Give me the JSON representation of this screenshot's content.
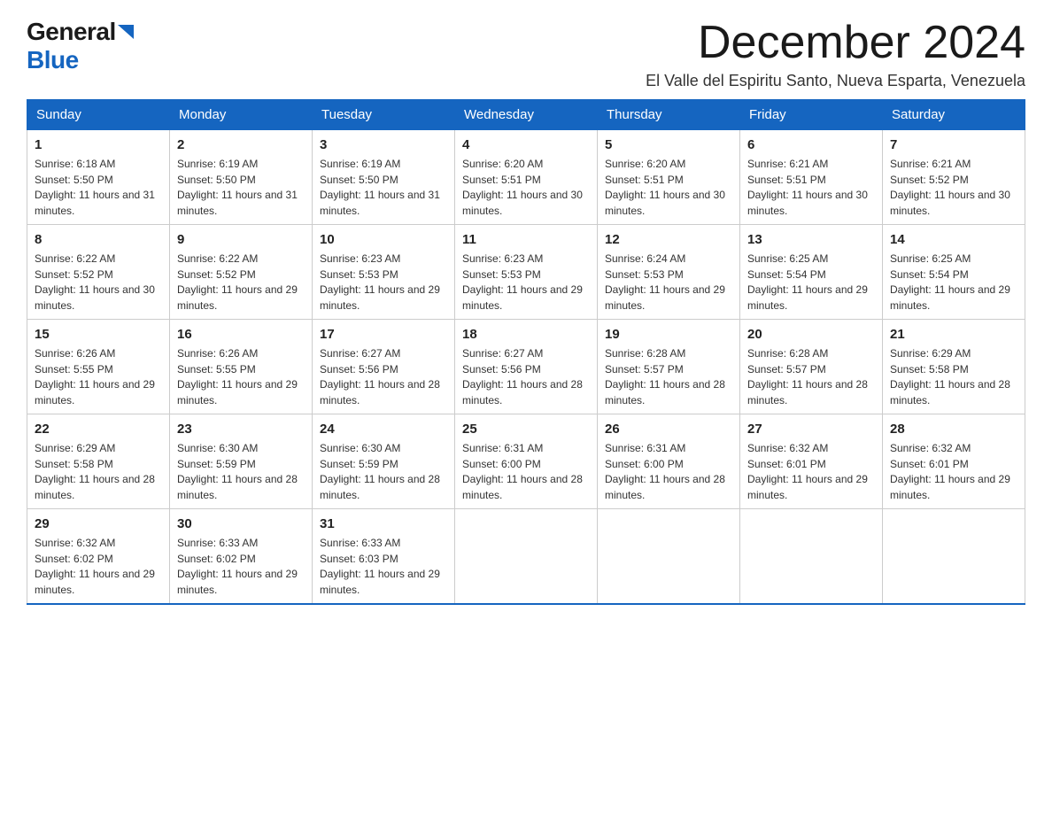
{
  "header": {
    "logo_general": "General",
    "logo_blue": "Blue",
    "month_title": "December 2024",
    "subtitle": "El Valle del Espiritu Santo, Nueva Esparta, Venezuela"
  },
  "weekdays": [
    "Sunday",
    "Monday",
    "Tuesday",
    "Wednesday",
    "Thursday",
    "Friday",
    "Saturday"
  ],
  "weeks": [
    [
      {
        "day": "1",
        "sunrise": "6:18 AM",
        "sunset": "5:50 PM",
        "daylight": "11 hours and 31 minutes."
      },
      {
        "day": "2",
        "sunrise": "6:19 AM",
        "sunset": "5:50 PM",
        "daylight": "11 hours and 31 minutes."
      },
      {
        "day": "3",
        "sunrise": "6:19 AM",
        "sunset": "5:50 PM",
        "daylight": "11 hours and 31 minutes."
      },
      {
        "day": "4",
        "sunrise": "6:20 AM",
        "sunset": "5:51 PM",
        "daylight": "11 hours and 30 minutes."
      },
      {
        "day": "5",
        "sunrise": "6:20 AM",
        "sunset": "5:51 PM",
        "daylight": "11 hours and 30 minutes."
      },
      {
        "day": "6",
        "sunrise": "6:21 AM",
        "sunset": "5:51 PM",
        "daylight": "11 hours and 30 minutes."
      },
      {
        "day": "7",
        "sunrise": "6:21 AM",
        "sunset": "5:52 PM",
        "daylight": "11 hours and 30 minutes."
      }
    ],
    [
      {
        "day": "8",
        "sunrise": "6:22 AM",
        "sunset": "5:52 PM",
        "daylight": "11 hours and 30 minutes."
      },
      {
        "day": "9",
        "sunrise": "6:22 AM",
        "sunset": "5:52 PM",
        "daylight": "11 hours and 29 minutes."
      },
      {
        "day": "10",
        "sunrise": "6:23 AM",
        "sunset": "5:53 PM",
        "daylight": "11 hours and 29 minutes."
      },
      {
        "day": "11",
        "sunrise": "6:23 AM",
        "sunset": "5:53 PM",
        "daylight": "11 hours and 29 minutes."
      },
      {
        "day": "12",
        "sunrise": "6:24 AM",
        "sunset": "5:53 PM",
        "daylight": "11 hours and 29 minutes."
      },
      {
        "day": "13",
        "sunrise": "6:25 AM",
        "sunset": "5:54 PM",
        "daylight": "11 hours and 29 minutes."
      },
      {
        "day": "14",
        "sunrise": "6:25 AM",
        "sunset": "5:54 PM",
        "daylight": "11 hours and 29 minutes."
      }
    ],
    [
      {
        "day": "15",
        "sunrise": "6:26 AM",
        "sunset": "5:55 PM",
        "daylight": "11 hours and 29 minutes."
      },
      {
        "day": "16",
        "sunrise": "6:26 AM",
        "sunset": "5:55 PM",
        "daylight": "11 hours and 29 minutes."
      },
      {
        "day": "17",
        "sunrise": "6:27 AM",
        "sunset": "5:56 PM",
        "daylight": "11 hours and 28 minutes."
      },
      {
        "day": "18",
        "sunrise": "6:27 AM",
        "sunset": "5:56 PM",
        "daylight": "11 hours and 28 minutes."
      },
      {
        "day": "19",
        "sunrise": "6:28 AM",
        "sunset": "5:57 PM",
        "daylight": "11 hours and 28 minutes."
      },
      {
        "day": "20",
        "sunrise": "6:28 AM",
        "sunset": "5:57 PM",
        "daylight": "11 hours and 28 minutes."
      },
      {
        "day": "21",
        "sunrise": "6:29 AM",
        "sunset": "5:58 PM",
        "daylight": "11 hours and 28 minutes."
      }
    ],
    [
      {
        "day": "22",
        "sunrise": "6:29 AM",
        "sunset": "5:58 PM",
        "daylight": "11 hours and 28 minutes."
      },
      {
        "day": "23",
        "sunrise": "6:30 AM",
        "sunset": "5:59 PM",
        "daylight": "11 hours and 28 minutes."
      },
      {
        "day": "24",
        "sunrise": "6:30 AM",
        "sunset": "5:59 PM",
        "daylight": "11 hours and 28 minutes."
      },
      {
        "day": "25",
        "sunrise": "6:31 AM",
        "sunset": "6:00 PM",
        "daylight": "11 hours and 28 minutes."
      },
      {
        "day": "26",
        "sunrise": "6:31 AM",
        "sunset": "6:00 PM",
        "daylight": "11 hours and 28 minutes."
      },
      {
        "day": "27",
        "sunrise": "6:32 AM",
        "sunset": "6:01 PM",
        "daylight": "11 hours and 29 minutes."
      },
      {
        "day": "28",
        "sunrise": "6:32 AM",
        "sunset": "6:01 PM",
        "daylight": "11 hours and 29 minutes."
      }
    ],
    [
      {
        "day": "29",
        "sunrise": "6:32 AM",
        "sunset": "6:02 PM",
        "daylight": "11 hours and 29 minutes."
      },
      {
        "day": "30",
        "sunrise": "6:33 AM",
        "sunset": "6:02 PM",
        "daylight": "11 hours and 29 minutes."
      },
      {
        "day": "31",
        "sunrise": "6:33 AM",
        "sunset": "6:03 PM",
        "daylight": "11 hours and 29 minutes."
      },
      null,
      null,
      null,
      null
    ]
  ]
}
